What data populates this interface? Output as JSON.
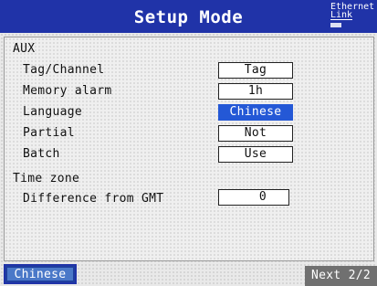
{
  "header": {
    "title": "Setup Mode",
    "ethernet_line1": "Ethernet",
    "ethernet_line2": "Link"
  },
  "aux": {
    "section_label": "AUX",
    "rows": [
      {
        "label": "Tag/Channel",
        "value": "Tag"
      },
      {
        "label": "Memory alarm",
        "value": "1h"
      },
      {
        "label": "Language",
        "value": "Chinese",
        "selected": true
      },
      {
        "label": "Partial",
        "value": "Not"
      },
      {
        "label": "Batch",
        "value": "Use"
      }
    ]
  },
  "time_zone": {
    "section_label": "Time zone",
    "difference_label": "Difference from GMT",
    "difference_value": "0"
  },
  "softkeys": {
    "left_label": "Chinese",
    "right_label": "Next 2/2"
  },
  "colors": {
    "title_bar": "#2033a8",
    "selection": "#2458d6",
    "softkey_next": "#707070"
  }
}
